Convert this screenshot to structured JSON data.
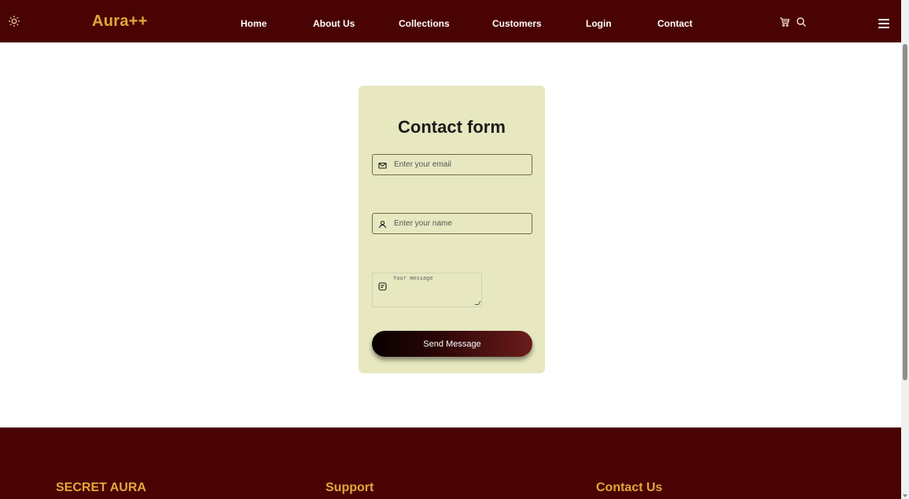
{
  "navbar": {
    "theme_icon": "sun-icon",
    "brand": "Aura++",
    "links": [
      "Home",
      "About Us",
      "Collections",
      "Customers",
      "Login",
      "Contact"
    ],
    "cart_icon": "cart-icon",
    "search_icon": "search-icon",
    "menu_icon": "hamburger-menu-icon"
  },
  "form": {
    "title": "Contact form",
    "email_placeholder": "Enter your email",
    "email_icon": "mail-icon",
    "name_placeholder": "Enter your name",
    "name_icon": "user-icon",
    "message_placeholder": "Your message",
    "message_icon": "message-icon",
    "submit_label": "Send Message"
  },
  "footer": {
    "headings": [
      "SECRET AURA",
      "Support",
      "Contact Us"
    ]
  },
  "colors": {
    "nav_bg": "#4a0303",
    "brand": "#e5a63a",
    "card_bg": "#e7e8c0",
    "button_gradient_start": "#090000",
    "button_gradient_end": "#6b1c1c"
  }
}
